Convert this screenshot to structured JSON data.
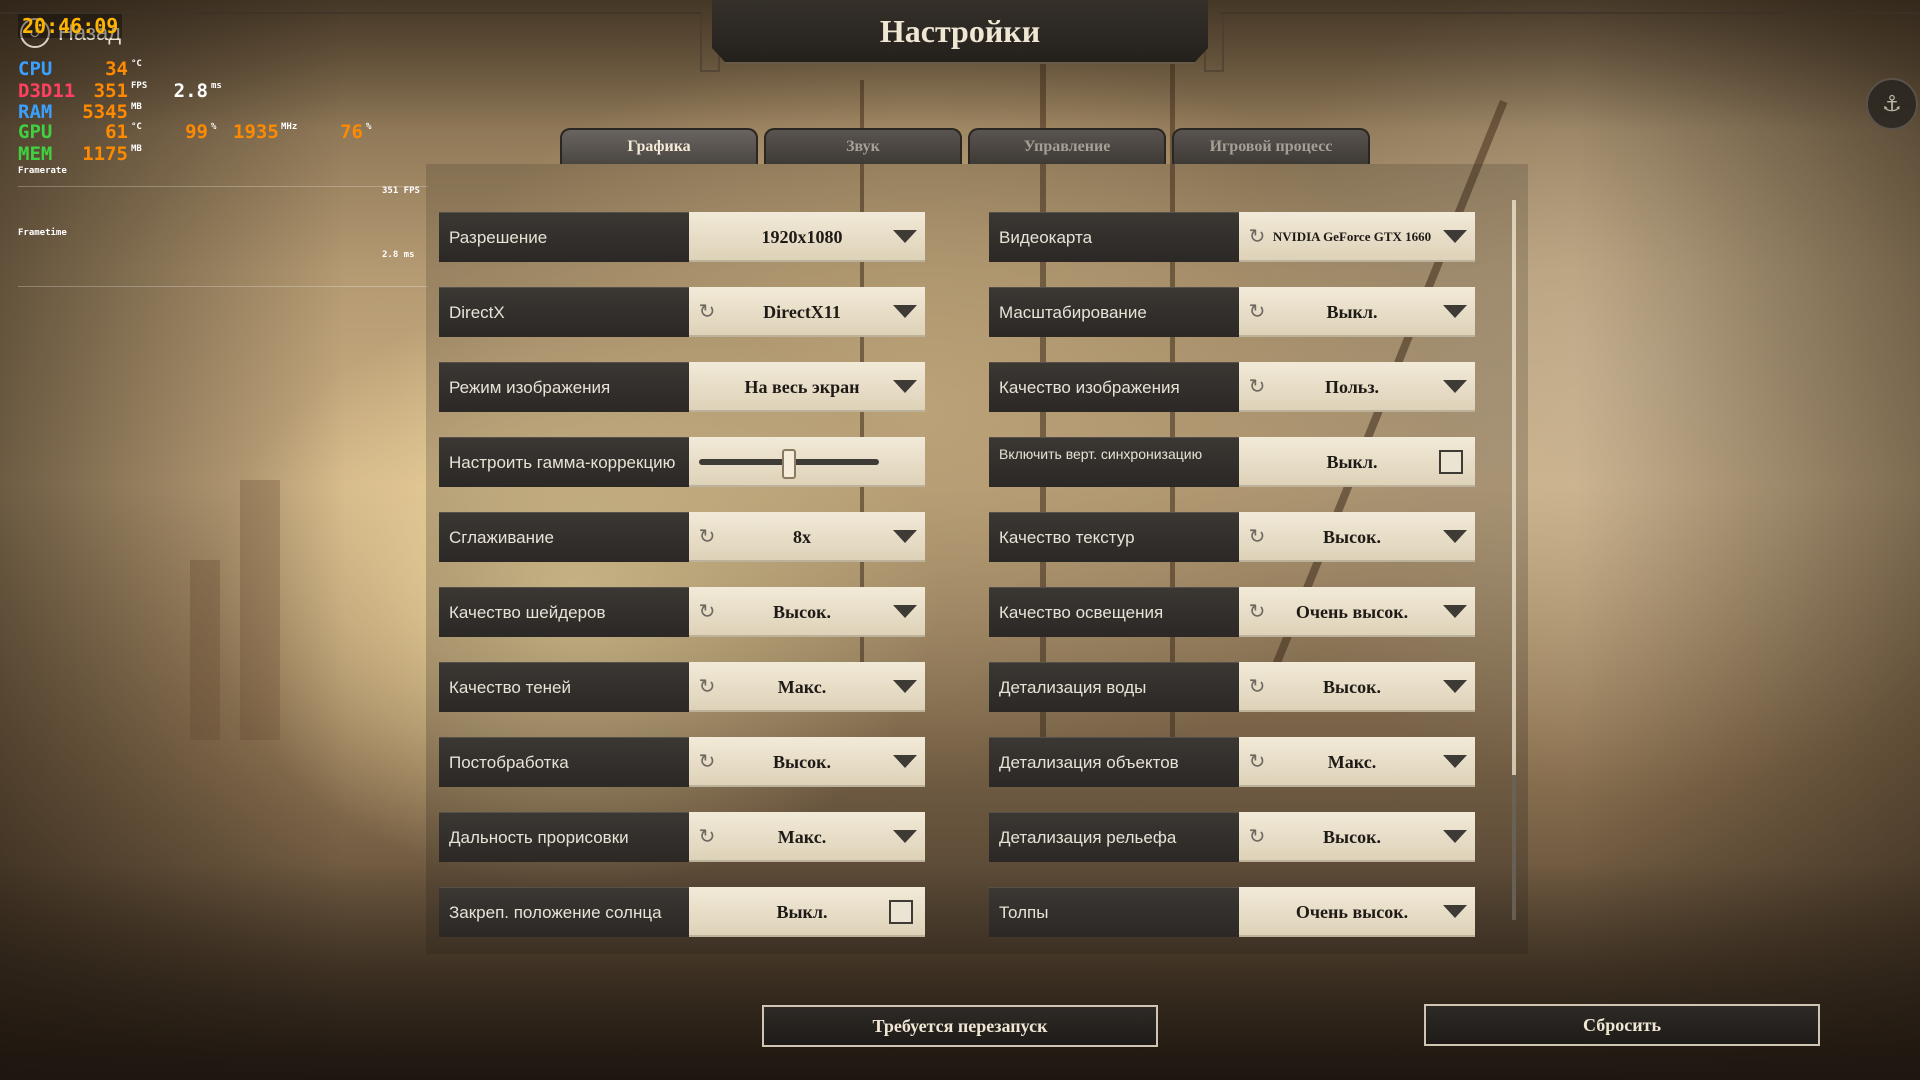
{
  "header": {
    "title": "Настройки",
    "back_label": "Назад",
    "back_icon": "back-arrow-icon",
    "corner_icon": "network-icon"
  },
  "perf": {
    "clock": "20:46:09",
    "rows": [
      {
        "label": "CPU",
        "label_color": "#3aa0ff",
        "value1": "34",
        "unit1": "°C"
      },
      {
        "label": "D3D11",
        "label_color": "#ff4060",
        "value1": "351",
        "unit1": "FPS",
        "value2": "2.8",
        "unit2": "ms"
      },
      {
        "label": "RAM",
        "label_color": "#3aa0ff",
        "value1": "5345",
        "unit1": "MB"
      },
      {
        "label": "GPU",
        "label_color": "#40d040",
        "value1": "61",
        "unit1": "°C",
        "value2": "99",
        "unit2": "%",
        "value3": "1935",
        "unit3": "MHz",
        "value4": "76",
        "unit4": "%"
      },
      {
        "label": "MEM",
        "label_color": "#40d040",
        "value1": "1175",
        "unit1": "MB"
      }
    ],
    "framerate_label": "Framerate",
    "frametime_label": "Frametime",
    "graph_fps": "351 FPS",
    "graph_ms": "2.8 ms"
  },
  "tabs": [
    {
      "label": "Графика",
      "active": true
    },
    {
      "label": "Звук",
      "active": false
    },
    {
      "label": "Управление",
      "active": false
    },
    {
      "label": "Игровой процесс",
      "active": false
    }
  ],
  "settings": {
    "left": [
      {
        "label": "Разрешение",
        "value": "1920x1080",
        "control": "dropdown",
        "reset": false
      },
      {
        "label": "DirectX",
        "value": "DirectX11",
        "control": "dropdown",
        "reset": true
      },
      {
        "label": "Режим изображения",
        "value": "На весь экран",
        "control": "dropdown",
        "reset": false
      },
      {
        "label": "Настроить гамма-коррекцию",
        "value": "",
        "control": "slider",
        "reset": false,
        "slider_level": 0.5
      },
      {
        "label": "Сглаживание",
        "value": "8x",
        "control": "dropdown",
        "reset": true
      },
      {
        "label": "Качество шейдеров",
        "value": "Высок.",
        "control": "dropdown",
        "reset": true
      },
      {
        "label": "Качество теней",
        "value": "Макс.",
        "control": "dropdown",
        "reset": true
      },
      {
        "label": "Постобработка",
        "value": "Высок.",
        "control": "dropdown",
        "reset": true
      },
      {
        "label": "Дальность прорисовки",
        "value": "Макс.",
        "control": "dropdown",
        "reset": true
      },
      {
        "label": "Закреп. положение солнца",
        "value": "Выкл.",
        "control": "checkbox",
        "reset": false
      }
    ],
    "right": [
      {
        "label": "Видеокарта",
        "value": "NVIDIA GeForce GTX 1660",
        "control": "dropdown",
        "reset": true,
        "tiny": true
      },
      {
        "label": "Масштабирование",
        "value": "Выкл.",
        "control": "dropdown",
        "reset": true
      },
      {
        "label": "Качество изображения",
        "value": "Польз.",
        "control": "dropdown",
        "reset": true
      },
      {
        "label": "Включить верт. синхронизацию",
        "value": "Выкл.",
        "control": "checkbox",
        "reset": false,
        "small": true
      },
      {
        "label": "Качество текстур",
        "value": "Высок.",
        "control": "dropdown",
        "reset": true
      },
      {
        "label": "Качество освещения",
        "value": "Очень высок.",
        "control": "dropdown",
        "reset": true
      },
      {
        "label": "Детализация воды",
        "value": "Высок.",
        "control": "dropdown",
        "reset": true
      },
      {
        "label": "Детализация объектов",
        "value": "Макс.",
        "control": "dropdown",
        "reset": true
      },
      {
        "label": "Детализация рельефа",
        "value": "Высок.",
        "control": "dropdown",
        "reset": true
      },
      {
        "label": "Толпы",
        "value": "Очень высок.",
        "control": "dropdown",
        "reset": false
      }
    ]
  },
  "footer": {
    "restart_label": "Требуется перезапуск",
    "reset_label": "Сбросить"
  }
}
